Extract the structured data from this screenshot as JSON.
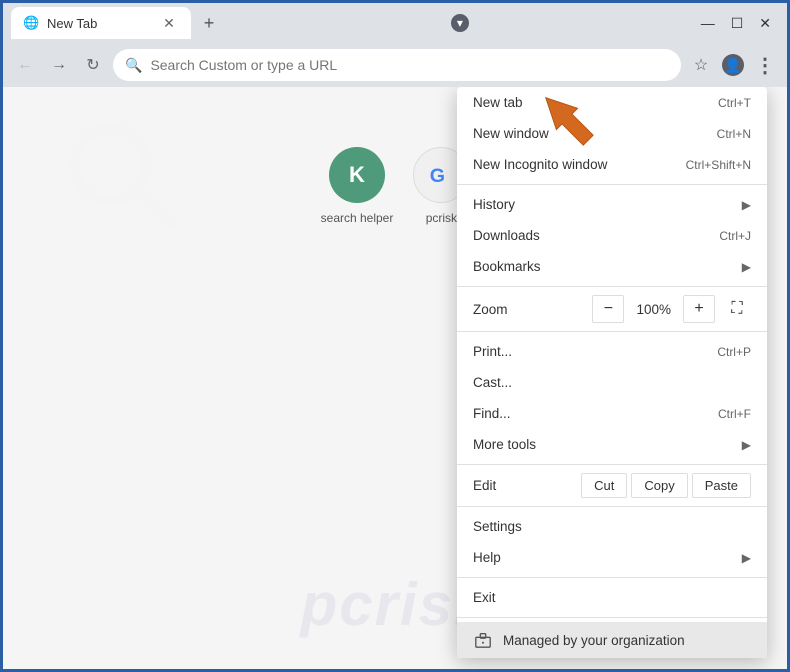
{
  "browser": {
    "tab_title": "New Tab",
    "tab_favicon": "🌐",
    "new_tab_btn": "+",
    "window_controls": {
      "minimize": "—",
      "maximize": "☐",
      "close": "✕"
    }
  },
  "toolbar": {
    "back_label": "←",
    "forward_label": "→",
    "reload_label": "↻",
    "address_placeholder": "Search Custom or type a URL",
    "bookmark_icon": "☆",
    "profile_icon": "👤",
    "menu_icon": "⋮"
  },
  "newtab": {
    "watermark": "pcrisk",
    "shortcuts": [
      {
        "label": "search helper",
        "letter": "K",
        "color": "#4caf50"
      },
      {
        "label": "pcrisk",
        "google_g": true,
        "color": "#e8eaf6"
      }
    ]
  },
  "menu": {
    "items": [
      {
        "id": "new-tab",
        "label": "New tab",
        "shortcut": "Ctrl+T",
        "has_submenu": false,
        "has_icon": false,
        "group": 1
      },
      {
        "id": "new-window",
        "label": "New window",
        "shortcut": "Ctrl+N",
        "has_submenu": false,
        "has_icon": false,
        "group": 1
      },
      {
        "id": "new-incognito",
        "label": "New Incognito window",
        "shortcut": "Ctrl+Shift+N",
        "has_submenu": false,
        "has_icon": false,
        "group": 1
      },
      {
        "id": "history",
        "label": "History",
        "shortcut": "",
        "has_submenu": true,
        "has_icon": false,
        "group": 2
      },
      {
        "id": "downloads",
        "label": "Downloads",
        "shortcut": "Ctrl+J",
        "has_submenu": false,
        "has_icon": false,
        "group": 2
      },
      {
        "id": "bookmarks",
        "label": "Bookmarks",
        "shortcut": "",
        "has_submenu": true,
        "has_icon": false,
        "group": 2
      },
      {
        "id": "zoom",
        "label": "Zoom",
        "minus": "−",
        "value": "100%",
        "plus": "+",
        "fullscreen": "⛶",
        "group": 3
      },
      {
        "id": "print",
        "label": "Print...",
        "shortcut": "Ctrl+P",
        "has_submenu": false,
        "has_icon": false,
        "group": 4
      },
      {
        "id": "cast",
        "label": "Cast...",
        "shortcut": "",
        "has_submenu": false,
        "has_icon": false,
        "group": 4
      },
      {
        "id": "find",
        "label": "Find...",
        "shortcut": "Ctrl+F",
        "has_submenu": false,
        "has_icon": false,
        "group": 4
      },
      {
        "id": "more-tools",
        "label": "More tools",
        "shortcut": "",
        "has_submenu": true,
        "has_icon": false,
        "group": 4
      },
      {
        "id": "edit",
        "label": "Edit",
        "cut": "Cut",
        "copy": "Copy",
        "paste": "Paste",
        "group": 5
      },
      {
        "id": "settings",
        "label": "Settings",
        "shortcut": "",
        "has_submenu": false,
        "has_icon": false,
        "group": 6
      },
      {
        "id": "help",
        "label": "Help",
        "shortcut": "",
        "has_submenu": true,
        "has_icon": false,
        "group": 6
      },
      {
        "id": "exit",
        "label": "Exit",
        "shortcut": "",
        "has_submenu": false,
        "has_icon": false,
        "group": 7
      },
      {
        "id": "managed",
        "label": "Managed by your organization",
        "shortcut": "",
        "has_submenu": false,
        "has_icon": true,
        "icon": "🏢",
        "group": 8,
        "highlighted": true
      }
    ]
  }
}
